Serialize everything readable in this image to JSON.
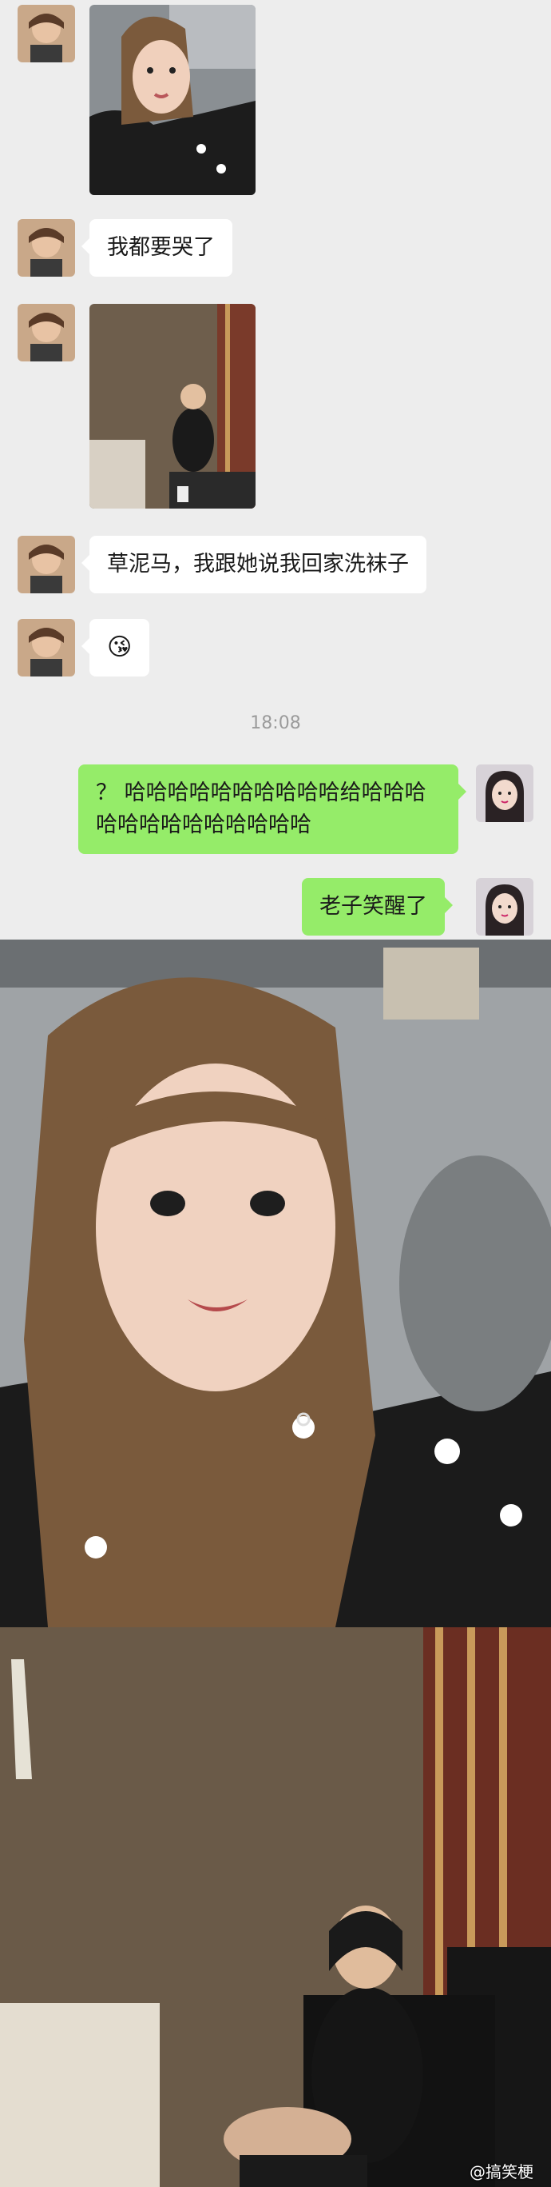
{
  "messages": [
    {
      "id": "m1",
      "type": "image",
      "from": "friend",
      "desc": "selfie"
    },
    {
      "id": "m2",
      "type": "text",
      "from": "friend",
      "text": "我都要哭了"
    },
    {
      "id": "m3",
      "type": "image",
      "from": "friend",
      "desc": "room photo"
    },
    {
      "id": "m4",
      "type": "text",
      "from": "friend",
      "text": "草泥马，我跟她说我回家洗袜子"
    },
    {
      "id": "m5",
      "type": "emoji",
      "from": "friend",
      "text": "😘"
    },
    {
      "id": "m6",
      "type": "text",
      "from": "me",
      "text": "？ 哈哈哈哈哈哈哈哈哈哈给哈哈哈哈哈哈哈哈哈哈哈哈哈"
    },
    {
      "id": "m7",
      "type": "text",
      "from": "me",
      "text": "老子笑醒了"
    }
  ],
  "timestamp": "18:08",
  "watermark": "@搞笑梗",
  "colors": {
    "background": "#ededed",
    "bubble_in": "#ffffff",
    "bubble_out": "#95ec69",
    "timestamp": "#9b9b9b"
  }
}
